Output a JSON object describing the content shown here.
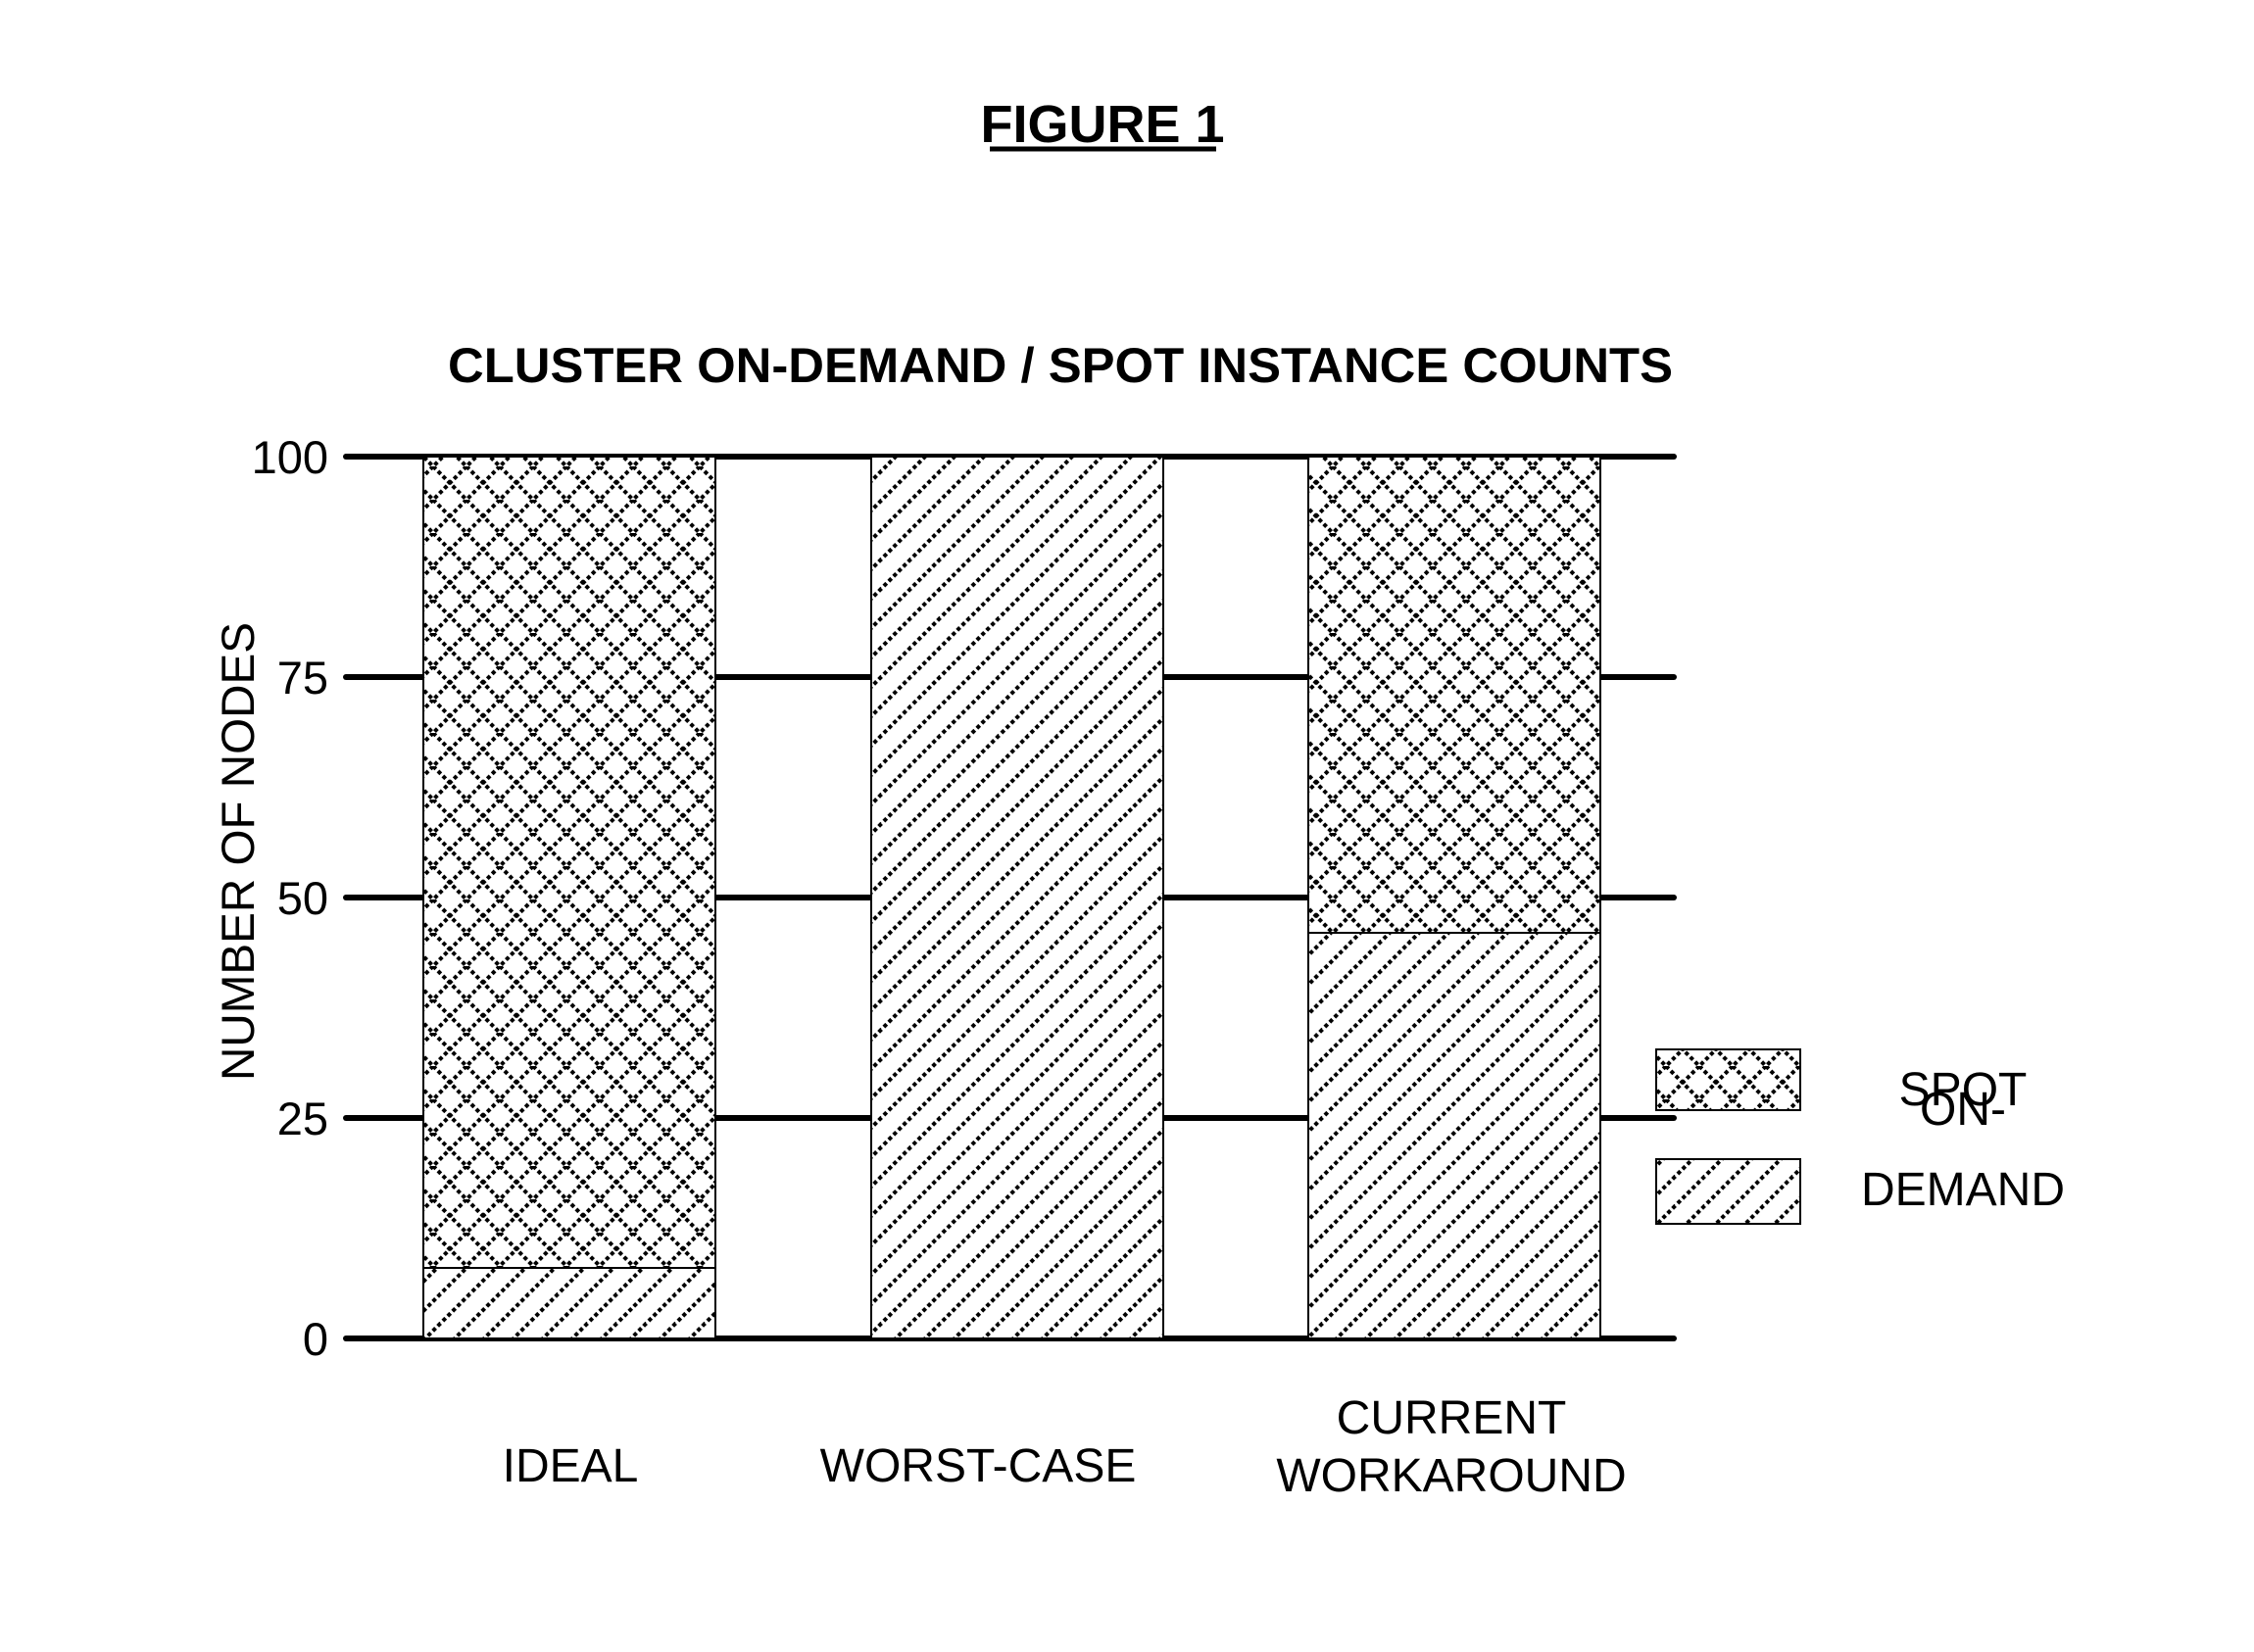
{
  "figure_title": "FIGURE 1",
  "chart_data": {
    "type": "bar",
    "stacked": true,
    "title": "CLUSTER ON-DEMAND / SPOT INSTANCE COUNTS",
    "xlabel": "",
    "ylabel": "NUMBER OF NODES",
    "ylim": [
      0,
      100
    ],
    "yticks": [
      0,
      25,
      50,
      75,
      100
    ],
    "ytick_labels": [
      "0",
      "25",
      "50",
      "75",
      "100"
    ],
    "grid": true,
    "categories": [
      {
        "lines": [
          "IDEAL"
        ]
      },
      {
        "lines": [
          "WORST-CASE"
        ]
      },
      {
        "lines": [
          "CURRENT",
          "WORKAROUND"
        ]
      }
    ],
    "category_names": [
      "IDEAL",
      "WORST-CASE",
      "CURRENT WORKAROUND"
    ],
    "series": [
      {
        "name": "ON-DEMAND",
        "pattern": "diagonal-hatch",
        "values": [
          8,
          100,
          46
        ]
      },
      {
        "name": "SPOT",
        "pattern": "crosshatch",
        "values": [
          92,
          0,
          54
        ]
      }
    ],
    "legend": {
      "placement": "right",
      "items": [
        {
          "series": "SPOT",
          "pattern": "crosshatch",
          "lines": [
            "SPOT"
          ]
        },
        {
          "series": "ON-DEMAND",
          "pattern": "diagonal-hatch",
          "lines": [
            "ON-",
            "DEMAND"
          ]
        }
      ]
    },
    "colors": {
      "ink": "#000000",
      "background": "#ffffff"
    }
  }
}
